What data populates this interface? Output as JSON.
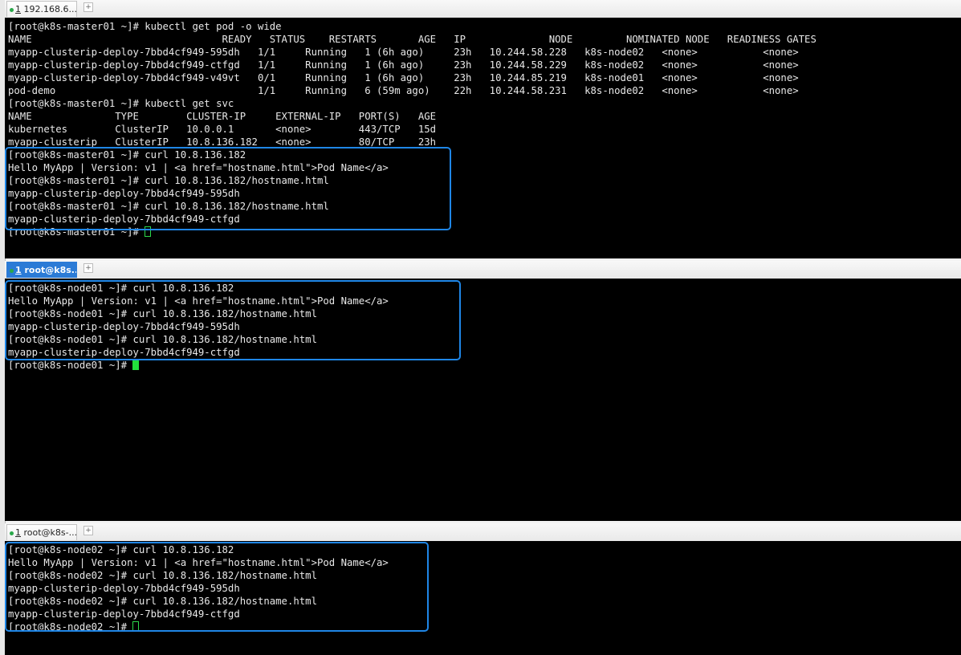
{
  "panes": [
    {
      "tab_label": "1 192.168.6...",
      "tab_num": "1",
      "tab_text": " 192.168.6...",
      "active": false,
      "lines": [
        "[root@k8s-master01 ~]# kubectl get pod -o wide",
        "NAME                                READY   STATUS    RESTARTS       AGE   IP              NODE         NOMINATED NODE   READINESS GATES",
        "myapp-clusterip-deploy-7bbd4cf949-595dh   1/1     Running   1 (6h ago)     23h   10.244.58.228   k8s-node02   <none>           <none>",
        "myapp-clusterip-deploy-7bbd4cf949-ctfgd   1/1     Running   1 (6h ago)     23h   10.244.58.229   k8s-node02   <none>           <none>",
        "myapp-clusterip-deploy-7bbd4cf949-v49vt   0/1     Running   1 (6h ago)     23h   10.244.85.219   k8s-node01   <none>           <none>",
        "pod-demo                                  1/1     Running   6 (59m ago)    22h   10.244.58.231   k8s-node02   <none>           <none>",
        "[root@k8s-master01 ~]# kubectl get svc",
        "NAME              TYPE        CLUSTER-IP     EXTERNAL-IP   PORT(S)   AGE",
        "kubernetes        ClusterIP   10.0.0.1       <none>        443/TCP   15d",
        "myapp-clusterip   ClusterIP   10.8.136.182   <none>        80/TCP    23h",
        "[root@k8s-master01 ~]# curl 10.8.136.182",
        "Hello MyApp | Version: v1 | <a href=\"hostname.html\">Pod Name</a>",
        "[root@k8s-master01 ~]# curl 10.8.136.182/hostname.html",
        "myapp-clusterip-deploy-7bbd4cf949-595dh",
        "[root@k8s-master01 ~]# curl 10.8.136.182/hostname.html",
        "myapp-clusterip-deploy-7bbd4cf949-ctfgd",
        "[root@k8s-master01 ~]# "
      ]
    },
    {
      "tab_label": "1 root@k8s...",
      "tab_num": "1",
      "tab_text": " root@k8s...",
      "active": true,
      "lines": [
        "[root@k8s-node01 ~]# curl 10.8.136.182",
        "Hello MyApp | Version: v1 | <a href=\"hostname.html\">Pod Name</a>",
        "[root@k8s-node01 ~]# curl 10.8.136.182/hostname.html",
        "myapp-clusterip-deploy-7bbd4cf949-595dh",
        "[root@k8s-node01 ~]# curl 10.8.136.182/hostname.html",
        "myapp-clusterip-deploy-7bbd4cf949-ctfgd",
        "[root@k8s-node01 ~]# "
      ]
    },
    {
      "tab_label": "1 root@k8s-...",
      "tab_num": "1",
      "tab_text": " root@k8s-...",
      "active": false,
      "lines": [
        "[root@k8s-node02 ~]# curl 10.8.136.182",
        "Hello MyApp | Version: v1 | <a href=\"hostname.html\">Pod Name</a>",
        "[root@k8s-node02 ~]# curl 10.8.136.182/hostname.html",
        "myapp-clusterip-deploy-7bbd4cf949-595dh",
        "[root@k8s-node02 ~]# curl 10.8.136.182/hostname.html",
        "myapp-clusterip-deploy-7bbd4cf949-ctfgd",
        "[root@k8s-node02 ~]# "
      ]
    }
  ],
  "add_tab_symbol": "+",
  "colors": {
    "terminal_bg": "#000000",
    "terminal_fg": "#e8e8e8",
    "highlight_border": "#1f86e6",
    "cursor": "#22e03c",
    "active_tab": "#2b7bd6"
  },
  "icons": {
    "tab_status": "green-dot-icon",
    "add_tab": "plus-icon",
    "cursor": "block-cursor-icon"
  }
}
